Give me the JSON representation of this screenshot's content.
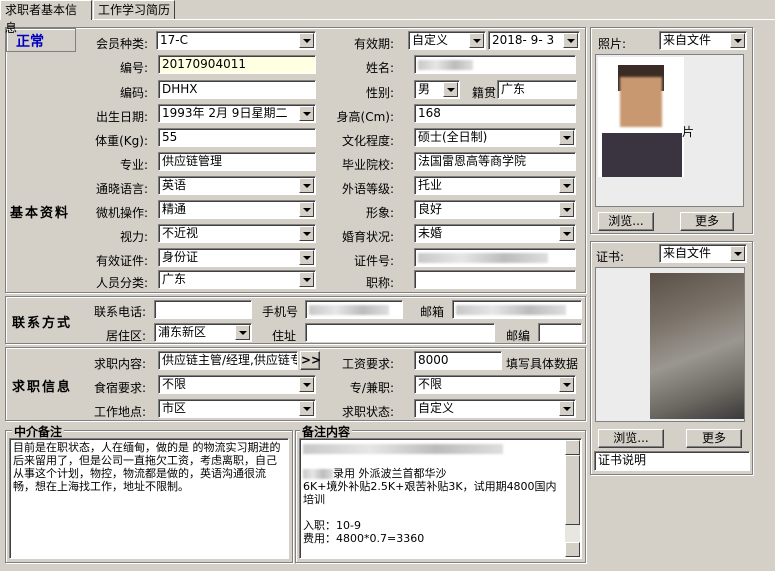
{
  "tabs": [
    "求职者基本信息",
    "工作学习简历"
  ],
  "status": "正常",
  "sections": {
    "basic": "基本资料",
    "contact": "联系方式",
    "job": "求职信息",
    "agent_note": "中介备注",
    "remark": "备注内容"
  },
  "labels": {
    "member_type": "会员种类:",
    "valid_period": "有效期:",
    "number": "编号:",
    "name": "姓名:",
    "code": "编码:",
    "gender": "性别:",
    "native": "籍贯",
    "birth": "出生日期:",
    "height": "身高(Cm):",
    "weight": "体重(Kg):",
    "education": "文化程度:",
    "major": "专业:",
    "school": "毕业院校:",
    "language": "通晓语言:",
    "foreign_level": "外语等级:",
    "computer": "微机操作:",
    "image": "形象:",
    "vision": "视力:",
    "marital": "婚育状况:",
    "id_type": "有效证件:",
    "id_no": "证件号:",
    "category": "人员分类:",
    "title": "职称:",
    "phone": "联系电话:",
    "mobile": "手机号",
    "email": "邮箱",
    "district": "居住区:",
    "address": "住址",
    "postcode": "邮编",
    "job_content": "求职内容:",
    "salary": "工资要求:",
    "salary_hint": "填写具体数据",
    "board": "食宿要求:",
    "fulltime": "专/兼职:",
    "location": "工作地点:",
    "job_status": "求职状态:",
    "photo": "照片:",
    "cert": "证书:"
  },
  "values": {
    "member_type": "17-C",
    "valid_type": "自定义",
    "valid_date": "2018- 9- 3",
    "number": "20170904011",
    "code": "DHHX",
    "gender": "男",
    "native": "广东",
    "birth": "1993年 2月 9日星期二",
    "height": "168",
    "weight": "55",
    "education": "硕士(全日制)",
    "major": "供应链管理",
    "school": "法国雷恩高等商学院",
    "language": "英语",
    "foreign_level": "托业",
    "computer": "精通",
    "image": "良好",
    "vision": "不近视",
    "marital": "未婚",
    "id_type": "身份证",
    "category": "广东",
    "district": "浦东新区",
    "job_content": "供应链主管/经理,供应链专",
    "salary": "8000",
    "board": "不限",
    "fulltime": "不限",
    "location": "市区",
    "job_status": "自定义",
    "photo_source": "来自文件",
    "cert_source": "来自文件",
    "cert_desc": "证书说明",
    "photo_caption": "片"
  },
  "buttons": {
    "browse": "浏览...",
    "more": "更多",
    "expand": ">>"
  },
  "agent_note_text": "目前是在职状态，人在缅甸，做的是 的物流实习期进的 后来留用了，但是公司一直拖欠工资，考虑离职，自己从事这个计划，物控，物流都是做的，英语沟通很流畅，想在上海找工作，地址不限制。",
  "remark_lines": [
    "录用 外派波兰首都华沙",
    "6K+境外补贴2.5K+艰苦补贴3K，试用期4800国内培训",
    "",
    "入职：10-9",
    "费用：4800*0.7=3360"
  ]
}
